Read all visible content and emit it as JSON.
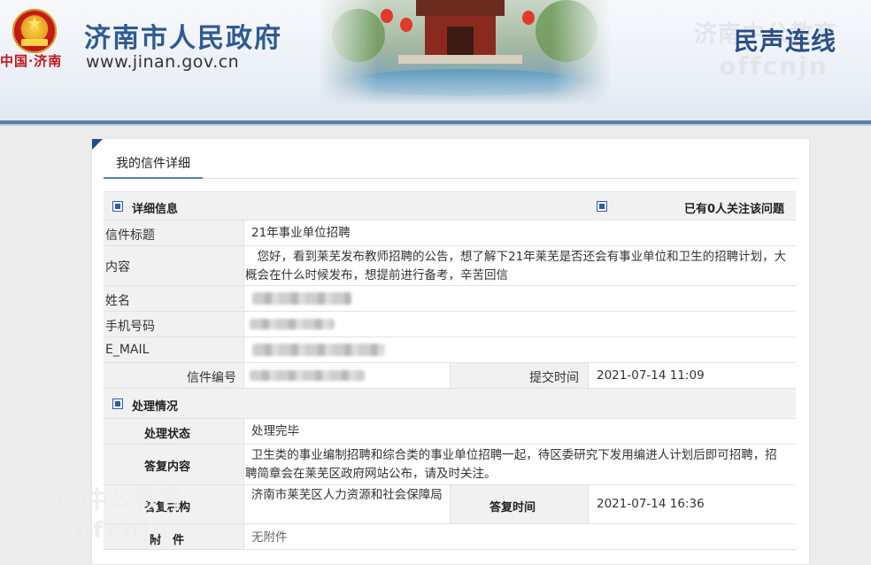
{
  "header": {
    "site_title": "济南市人民政府",
    "site_url": "www.jinan.gov.cn",
    "brand_text": "中国·济南",
    "channel_title": "民声连线",
    "watermark_cn": "济南中公教育",
    "watermark_en": "offcnjn"
  },
  "tab": {
    "label": "我的信件详细"
  },
  "detail": {
    "section_title": "详细信息",
    "follow_count_text": "已有0人关注该问题",
    "fields": {
      "title_label": "信件标题",
      "title_value": "21年事业单位招聘",
      "content_label": "内容",
      "content_value": "您好，看到莱芜发布教师招聘的公告，想了解下21年莱芜是否还会有事业单位和卫生的招聘计划，大概会在什么时候发布，想提前进行备考，辛苦回信",
      "name_label": "姓名",
      "phone_label": "手机号码",
      "email_label": "E_MAIL",
      "letter_no_label": "信件编号",
      "submit_time_label": "提交时间",
      "submit_time_value": "2021-07-14 11:09"
    }
  },
  "handling": {
    "section_title": "处理情况",
    "status_label": "处理状态",
    "status_value": "处理完毕",
    "reply_label": "答复内容",
    "reply_value": "卫生类的事业编制招聘和综合类的事业单位招聘一起，待区委研究下发用编进人计划后即可招聘，招聘简章会在莱芜区政府网站公布，请及时关注。",
    "org_label": "答复机构",
    "org_value": "济南市莱芜区人力资源和社会保障局",
    "reply_time_label": "答复时间",
    "reply_time_value": "2021-07-14 16:36",
    "attachment_label": "附　件",
    "attachment_value": "无附件"
  },
  "colors": {
    "brand_blue": "#2f5a93",
    "header_rule": "#5d7ea3",
    "icon_blue": "#2f5ea6",
    "row_grey": "#f1f1f1"
  }
}
